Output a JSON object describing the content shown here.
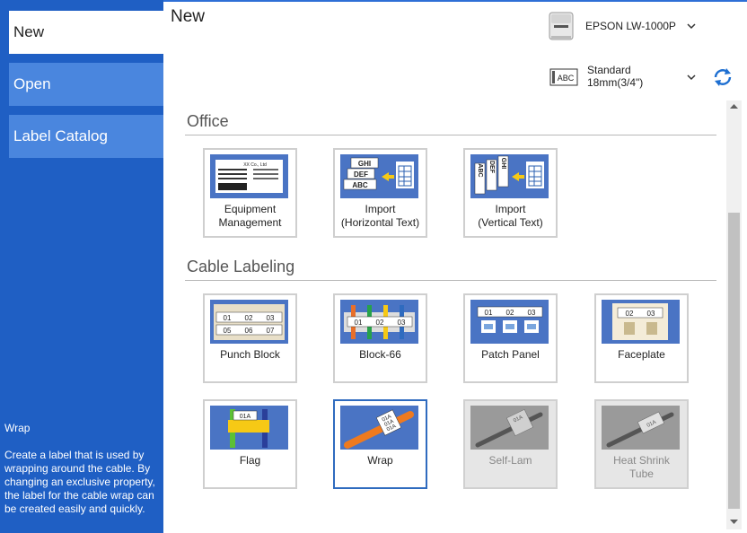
{
  "sidebar": {
    "items": [
      {
        "label": "New"
      },
      {
        "label": "Open"
      },
      {
        "label": "Label Catalog"
      }
    ],
    "description_title": "Wrap",
    "description_text": "Create a label that is used by wrapping around the cable. By changing an exclusive property, the label for the cable wrap can be created easily and quickly."
  },
  "header": {
    "title": "New",
    "printer": "EPSON LW-1000P",
    "tape_line1": "Standard",
    "tape_line2": "18mm(3/4\")",
    "tape_icon_text": "ABC"
  },
  "sections": {
    "office": {
      "title": "Office",
      "tiles": [
        {
          "line1": "Equipment",
          "line2": "Management"
        },
        {
          "line1": "Import",
          "line2": "(Horizontal Text)"
        },
        {
          "line1": "Import",
          "line2": "(Vertical Text)"
        }
      ]
    },
    "cable": {
      "title": "Cable Labeling",
      "tiles": [
        {
          "line1": "Punch Block"
        },
        {
          "line1": "Block-66"
        },
        {
          "line1": "Patch Panel"
        },
        {
          "line1": "Faceplate"
        },
        {
          "line1": "Flag"
        },
        {
          "line1": "Wrap"
        },
        {
          "line1": "Self-Lam"
        },
        {
          "line1": "Heat Shrink",
          "line2": "Tube"
        }
      ]
    }
  },
  "thumb_text": {
    "equip_company": "XX Co., Ltd",
    "ghi": "GHI",
    "def": "DEF",
    "abc": "ABC",
    "v_abc": "ABC",
    "v_def": "DEF",
    "v_ghi": "GHI",
    "c01": "01",
    "c02": "02",
    "c03": "03",
    "c05": "05",
    "c06": "06",
    "c07": "07",
    "c01a": "01A"
  },
  "colors": {
    "sidebar": "#1f5fc4",
    "nav_item": "#4a86de",
    "thumb_blue": "#4a74c4",
    "selected_border": "#2f6bbf"
  },
  "icons": [
    "printer-icon",
    "tape-icon",
    "chevron-down-icon",
    "refresh-icon"
  ]
}
